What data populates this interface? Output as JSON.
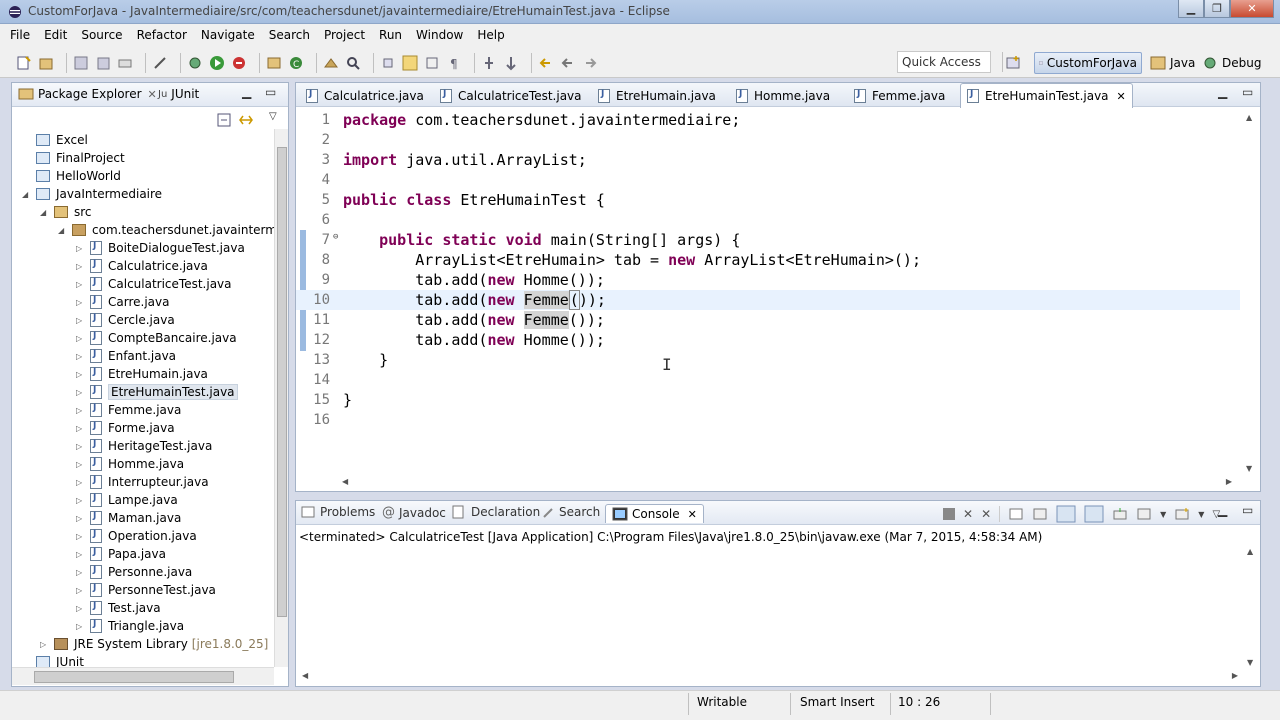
{
  "window": {
    "title": "CustomForJava - JavaIntermediaire/src/com/teachersdunet/javaintermediaire/EtreHumainTest.java - Eclipse"
  },
  "menu": [
    "File",
    "Edit",
    "Source",
    "Refactor",
    "Navigate",
    "Search",
    "Project",
    "Run",
    "Window",
    "Help"
  ],
  "toolbar": {
    "quick_access": "Quick Access",
    "perspectives": [
      "CustomForJava",
      "Java",
      "Debug"
    ]
  },
  "package_explorer": {
    "tabs": [
      "Package Explorer",
      "JUnit"
    ],
    "projects_top": [
      "Excel",
      "FinalProject",
      "HelloWorld",
      "JavaIntermediaire"
    ],
    "src": "src",
    "package": "com.teachersdunet.javaintermedi",
    "files": [
      "BoiteDialogueTest.java",
      "Calculatrice.java",
      "CalculatriceTest.java",
      "Carre.java",
      "Cercle.java",
      "CompteBancaire.java",
      "Enfant.java",
      "EtreHumain.java",
      "EtreHumainTest.java",
      "Femme.java",
      "Forme.java",
      "HeritageTest.java",
      "Homme.java",
      "Interrupteur.java",
      "Lampe.java",
      "Maman.java",
      "Operation.java",
      "Papa.java",
      "Personne.java",
      "PersonneTest.java",
      "Test.java",
      "Triangle.java"
    ],
    "selected_file": "EtreHumainTest.java",
    "library": "JRE System Library",
    "library_version": "[jre1.8.0_25]",
    "project_bottom": "JUnit"
  },
  "editor": {
    "tabs": [
      "Calculatrice.java",
      "CalculatriceTest.java",
      "EtreHumain.java",
      "Homme.java",
      "Femme.java",
      "EtreHumainTest.java"
    ],
    "active_tab": "EtreHumainTest.java",
    "line_numbers": [
      "1",
      "2",
      "3",
      "4",
      "5",
      "6",
      "7",
      "8",
      "9",
      "10",
      "11",
      "12",
      "13",
      "14",
      "15",
      "16"
    ],
    "code": {
      "l1_kw": "package",
      "l1_rest": " com.teachersdunet.javaintermediaire;",
      "l3_kw": "import",
      "l3_rest": " java.util.ArrayList;",
      "l5_kw1": "public",
      "l5_kw2": "class",
      "l5_rest": " EtreHumainTest {",
      "l7_indent": "    ",
      "l7_kw1": "public",
      "l7_kw2": "static",
      "l7_kw3": "void",
      "l7_rest": " main(String[] args) {",
      "l8_a": "        ArrayList<EtreHumain> tab = ",
      "l8_kw": "new",
      "l8_b": " ArrayList<EtreHumain>();",
      "l9_a": "        tab.add(",
      "l9_kw": "new",
      "l9_b": " Homme());",
      "l10_a": "        tab.add(",
      "l10_kw": "new",
      "l10_sp": " ",
      "l10_hl": "Femme",
      "l10_b": "(",
      "l10_c": "));",
      "l11_a": "        tab.add(",
      "l11_kw": "new",
      "l11_sp": " ",
      "l11_hl": "Femme",
      "l11_b": "());",
      "l12_a": "        tab.add(",
      "l12_kw": "new",
      "l12_b": " Homme());",
      "l13": "    }",
      "l15": "}"
    }
  },
  "console": {
    "tabs": [
      "Problems",
      "Javadoc",
      "Declaration",
      "Search",
      "Console"
    ],
    "active_tab": "Console",
    "status": "<terminated> CalculatriceTest [Java Application] C:\\Program Files\\Java\\jre1.8.0_25\\bin\\javaw.exe (Mar 7, 2015, 4:58:34 AM)"
  },
  "statusbar": {
    "writable": "Writable",
    "insert_mode": "Smart Insert",
    "position": "10 : 26"
  }
}
